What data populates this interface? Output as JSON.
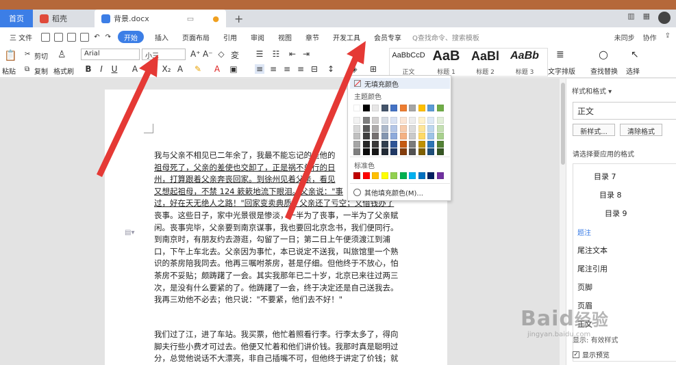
{
  "tabs": {
    "home": "首页",
    "daoke": "稻壳",
    "doc": "背景.docx",
    "add": "+"
  },
  "menu": {
    "file": "三 文件",
    "items": [
      "开始",
      "插入",
      "页面布局",
      "引用",
      "审阅",
      "视图",
      "章节",
      "开发工具",
      "会员专享"
    ],
    "search": "Q查找命令、搜索模板",
    "unsync": "未同步",
    "collab": "协作"
  },
  "ribbon": {
    "paste": "粘贴",
    "cut": "剪切",
    "copy": "复制",
    "format_painter": "格式刷",
    "font_name": "Arial",
    "font_size": "小三",
    "text_layout": "文字排版",
    "find_replace": "查找替换",
    "select": "选择",
    "styles": [
      {
        "sample": "AaBbCcD",
        "name": "正文"
      },
      {
        "sample": "AaB",
        "name": "标题 1"
      },
      {
        "sample": "AaBl",
        "name": "标题 2"
      },
      {
        "sample": "AaBb",
        "name": "标题 3"
      }
    ]
  },
  "dropdown": {
    "no_fill": "无填充颜色",
    "theme_colors": "主题颜色",
    "standard_colors": "标准色",
    "more_colors": "其他填充颜色(M)...",
    "theme_top_row": [
      "#ffffff",
      "#000000",
      "#e7e6e6",
      "#44546a",
      "#4472c4",
      "#ed7d31",
      "#a5a5a5",
      "#ffc000",
      "#5b9bd5",
      "#70ad47"
    ],
    "theme_shades": [
      [
        "#f2f2f2",
        "#7f7f7f",
        "#d0cece",
        "#d6dce4",
        "#d9e2f3",
        "#fbe5d5",
        "#ededed",
        "#fff2cc",
        "#deeaf6",
        "#e2efd9"
      ],
      [
        "#d8d8d8",
        "#595959",
        "#aeabab",
        "#adb9ca",
        "#b4c6e7",
        "#f7cbac",
        "#dbdbdb",
        "#fee598",
        "#bdd7ee",
        "#c5e0b3"
      ],
      [
        "#bfbfbf",
        "#3f3f3f",
        "#757070",
        "#8496b0",
        "#8eaadb",
        "#f4b183",
        "#c9c9c9",
        "#ffd965",
        "#9dc3e6",
        "#a8d08d"
      ],
      [
        "#a5a5a5",
        "#262626",
        "#3a3838",
        "#323f4f",
        "#2f5496",
        "#c55a11",
        "#7b7b7b",
        "#bf9000",
        "#2e75b5",
        "#538135"
      ],
      [
        "#7f7f7f",
        "#0c0c0c",
        "#171616",
        "#222a35",
        "#1f3864",
        "#833c0b",
        "#525252",
        "#7f6000",
        "#1e4e79",
        "#375623"
      ]
    ],
    "standard": [
      "#c00000",
      "#ff0000",
      "#ffc000",
      "#ffff00",
      "#92d050",
      "#00b050",
      "#00b0f0",
      "#0070c0",
      "#002060",
      "#7030a0"
    ]
  },
  "document": {
    "p1_lines": [
      {
        "text": "我与父亲不相见已二年余了，我最不能忘记的是他的",
        "u": false
      },
      {
        "text": "祖母死了，父亲的差使也交卸了，正是祸不单行的日",
        "u": true
      },
      {
        "text": "州，打算跟着父亲奔丧回家。到徐州见着父亲，看见",
        "u": true
      },
      {
        "text": "又想起祖母，不禁 124 簌簌地流下眼泪。父亲说：\"事",
        "u": true
      },
      {
        "text": "过，好在天无绝人之路！\"回家变卖典质，父亲还了亏空；又借钱办了",
        "u": true
      },
      {
        "text": "丧事。这些日子，家中光景很是惨淡，一半为了丧事，一半为了父亲赋",
        "u": false
      },
      {
        "text": "闲。丧事完毕，父亲要到南京谋事，我也要回北京念书，我们便同行。",
        "u": false
      },
      {
        "text": "到南京时，有朋友约去游逛，勾留了一日；第二日上午便须渡江到浦",
        "u": false
      },
      {
        "text": "口，下午上车北去。父亲因为事忙，本已说定不送我，叫旅馆里一个熟",
        "u": false
      },
      {
        "text": "识的茶房陪我同去。他再三嘱咐茶房，甚是仔细。但他终于不放心，怕",
        "u": false
      },
      {
        "text": "茶房不妥贴；颇踌躇了一会。其实我那年已二十岁，北京已来往过两三",
        "u": false
      },
      {
        "text": "次，是没有什么要紧的了。他踌躇了一会，终于决定还是自己送我去。",
        "u": false
      },
      {
        "text": "我再三劝他不必去；他只说：\"不要紧，他们去不好！\"",
        "u": false
      }
    ],
    "p2_lines": [
      "我们过了江，进了车站。我买票，他忙着照看行李。行李太多了，得向",
      "脚夫行些小费才可过去。他便又忙着和他们讲价钱。我那时真是聪明过",
      "分，总觉他说话不大漂亮，非自己插嘴不可，但他终于讲定了价钱；就"
    ]
  },
  "panel": {
    "title": "样式和格式 ▾",
    "current": "正文",
    "new_style": "新样式...",
    "clear_format": "清除格式",
    "apply_label": "请选择要应用的格式",
    "items": [
      {
        "text": "目录 7",
        "link": false
      },
      {
        "text": "目录 8",
        "link": false
      },
      {
        "text": "目录 9",
        "link": false
      },
      {
        "text": "题注",
        "link": true
      },
      {
        "text": "尾注文本",
        "link": false
      },
      {
        "text": "尾注引用",
        "link": false
      },
      {
        "text": "页脚",
        "link": false
      },
      {
        "text": "页眉",
        "link": false
      },
      {
        "text": "正文",
        "link": false
      }
    ],
    "filter_label": "显示",
    "filter_value": "有效样式",
    "preview": "显示预览"
  },
  "colors": {
    "accent": "#3c7ee6",
    "arrow": "#e53935",
    "titlebar": "#b5683a"
  },
  "watermark": {
    "big": "Baid",
    "cn": "经验",
    "small": "jingyan.baidu.com"
  }
}
